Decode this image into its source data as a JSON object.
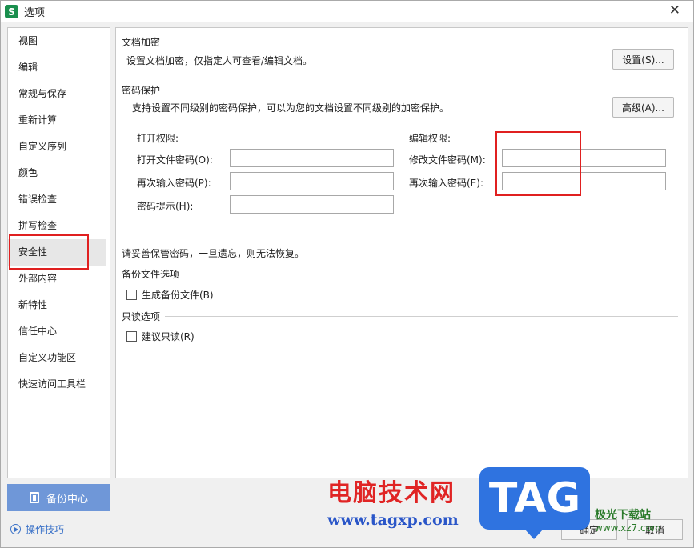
{
  "window": {
    "title": "选项",
    "app_icon_letter": "S"
  },
  "sidebar": {
    "items": [
      {
        "label": "视图"
      },
      {
        "label": "编辑"
      },
      {
        "label": "常规与保存"
      },
      {
        "label": "重新计算"
      },
      {
        "label": "自定义序列"
      },
      {
        "label": "颜色"
      },
      {
        "label": "错误检查"
      },
      {
        "label": "拼写检查"
      },
      {
        "label": "安全性"
      },
      {
        "label": "外部内容"
      },
      {
        "label": "新特性"
      },
      {
        "label": "信任中心"
      },
      {
        "label": "自定义功能区"
      },
      {
        "label": "快速访问工具栏"
      }
    ],
    "active": "安全性",
    "backup_label": "备份中心",
    "tips_label": "操作技巧"
  },
  "encryption": {
    "title": "文档加密",
    "desc": "设置文档加密，仅指定人可查看/编辑文档。",
    "button": "设置(S)..."
  },
  "password": {
    "title": "密码保护",
    "desc": "支持设置不同级别的密码保护，可以为您的文档设置不同级别的加密保护。",
    "button": "高级(A)...",
    "open_group": "打开权限:",
    "open_password": "打开文件密码(O):",
    "open_confirm": "再次输入密码(P):",
    "hint": "密码提示(H):",
    "edit_group": "编辑权限:",
    "edit_password": "修改文件密码(M):",
    "edit_confirm": "再次输入密码(E):",
    "warning": "请妥善保管密码，一旦遗忘，则无法恢复。"
  },
  "backup": {
    "title": "备份文件选项",
    "checkbox": "生成备份文件(B)"
  },
  "readonly": {
    "title": "只读选项",
    "checkbox": "建议只读(R)"
  },
  "footer": {
    "ok": "确定",
    "cancel": "取消"
  },
  "watermark": {
    "cn": "电脑技术网",
    "url": "www.tagxp.com",
    "tag": "TAG",
    "jg_cn": "极光下载站",
    "jg_url": "www.xz7.com"
  },
  "colors": {
    "highlight": "#e02020",
    "backup_button": "#6f97d8",
    "tips_link": "#3b72c8"
  }
}
